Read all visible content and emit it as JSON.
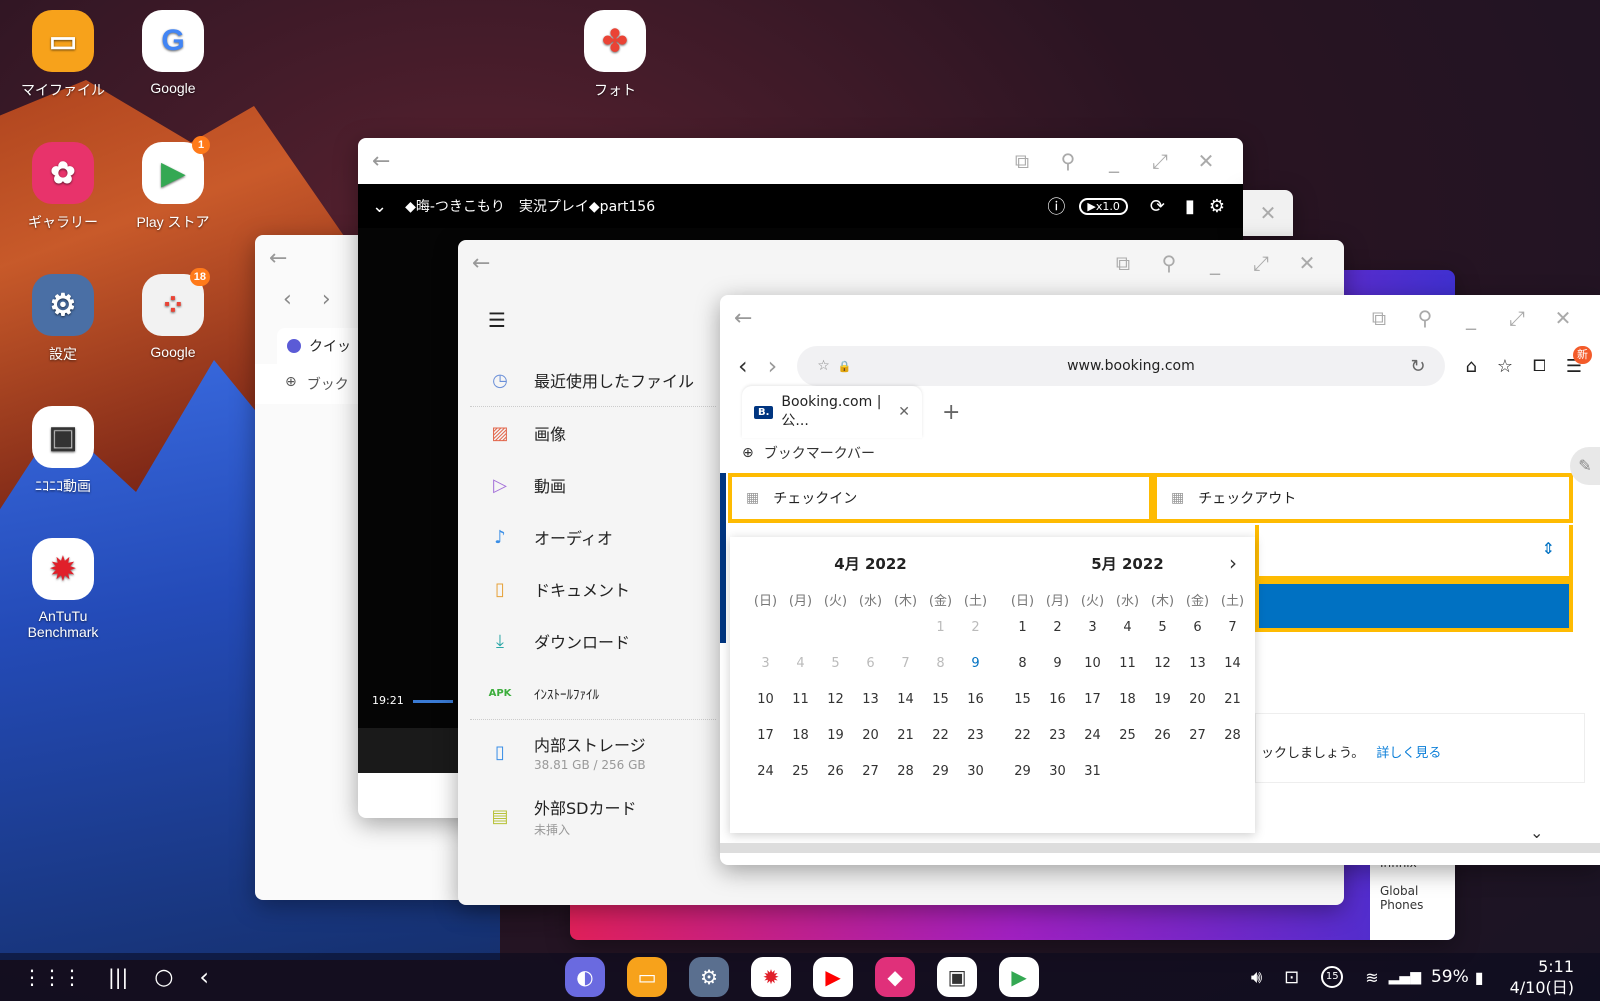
{
  "desktop": {
    "apps": [
      {
        "label": "マイファイル",
        "icon": "folder-icon",
        "color": "#f7a21b"
      },
      {
        "label": "Google",
        "icon": "google-icon",
        "color": "#ffffff"
      },
      {
        "label": "フォト",
        "icon": "photos-icon",
        "color": "#ffffff"
      },
      {
        "label": "ギャラリー",
        "icon": "gallery-icon",
        "color": "#e8336b"
      },
      {
        "label": "Play ストア",
        "icon": "play-store-icon",
        "color": "#ffffff",
        "badge": "1"
      },
      {
        "label": "設定",
        "icon": "settings-icon",
        "color": "#4a6fa5"
      },
      {
        "label": "Google",
        "icon": "google-folder-icon",
        "color": "#f2f2f2",
        "badge": "18"
      },
      {
        "label": "ﾆｺﾆｺ動画",
        "icon": "niconico-icon",
        "color": "#ffffff"
      },
      {
        "label": "AnTuTu Benchmark",
        "icon": "antutu-icon",
        "color": "#ffffff"
      }
    ]
  },
  "video_window": {
    "title": "◆晦-つきこもり　実況プレイ◆part156",
    "speed": "▶x1.0",
    "time": "19:21"
  },
  "back_browser": {
    "tab_label": "クイッ",
    "bookmark_label": "ブック"
  },
  "file_manager": {
    "items": [
      {
        "label": "最近使用したファイル",
        "icon": "clock-icon"
      },
      {
        "label": "画像",
        "icon": "image-icon"
      },
      {
        "label": "動画",
        "icon": "video-icon"
      },
      {
        "label": "オーディオ",
        "icon": "music-icon"
      },
      {
        "label": "ドキュメント",
        "icon": "document-icon"
      },
      {
        "label": "ダウンロード",
        "icon": "download-icon"
      },
      {
        "label": "ｲﾝｽﾄｰﾙﾌｧｲﾙ",
        "icon": "apk-icon",
        "icon_text": "APK"
      }
    ],
    "storage": [
      {
        "label": "内部ストレージ",
        "sub": "38.81 GB / 256 GB"
      },
      {
        "label": "外部SDカード",
        "sub": "未挿入"
      }
    ]
  },
  "browser": {
    "url": "www.booking.com",
    "tab_title": "Booking.com | 公...",
    "menu_badge": "新",
    "bookmark_bar": "ブックマークバー",
    "checkin": "チェックイン",
    "checkout": "チェックアウト",
    "promo_text": "ックしましょう。",
    "promo_link": "詳しく見る",
    "side_items": [
      "Infinix",
      "Global Phones"
    ],
    "calendar": {
      "weekdays": [
        "(日)",
        "(月)",
        "(火)",
        "(水)",
        "(木)",
        "(金)",
        "(土)"
      ],
      "months": [
        {
          "title": "4月 2022",
          "weeks": [
            [
              "",
              "",
              "",
              "",
              "",
              "1",
              "2"
            ],
            [
              "3",
              "4",
              "5",
              "6",
              "7",
              "8",
              "9"
            ],
            [
              "10",
              "11",
              "12",
              "13",
              "14",
              "15",
              "16"
            ],
            [
              "17",
              "18",
              "19",
              "20",
              "21",
              "22",
              "23"
            ],
            [
              "24",
              "25",
              "26",
              "27",
              "28",
              "29",
              "30"
            ]
          ]
        },
        {
          "title": "5月 2022",
          "weeks": [
            [
              "1",
              "2",
              "3",
              "4",
              "5",
              "6",
              "7"
            ],
            [
              "8",
              "9",
              "10",
              "11",
              "12",
              "13",
              "14"
            ],
            [
              "15",
              "16",
              "17",
              "18",
              "19",
              "20",
              "21"
            ],
            [
              "22",
              "23",
              "24",
              "25",
              "26",
              "27",
              "28"
            ],
            [
              "29",
              "30",
              "31",
              "",
              "",
              "",
              ""
            ]
          ]
        }
      ],
      "today": "9"
    }
  },
  "taskbar": {
    "apps": [
      "internet-icon",
      "my-files-icon",
      "settings-icon",
      "antutu-icon",
      "youtube-icon",
      "galaxy-store-icon",
      "niconico-icon",
      "play-store-icon"
    ],
    "notification_count": "15",
    "battery": "59%",
    "time": "5:11",
    "date": "4/10(日)"
  },
  "colors": {
    "booking_yellow": "#febb02",
    "booking_blue": "#0071c2",
    "link_blue": "#0a7ed8"
  }
}
